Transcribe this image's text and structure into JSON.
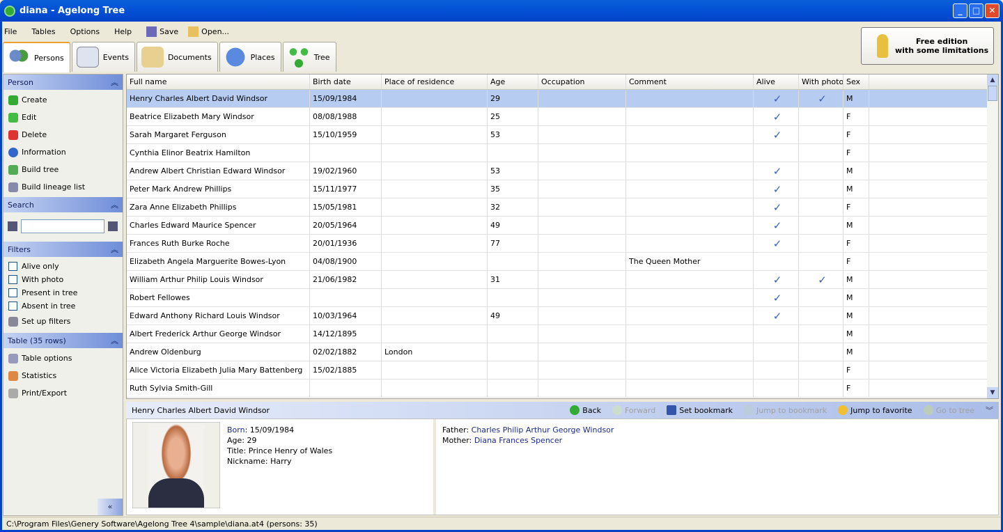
{
  "window": {
    "title": "diana - Agelong Tree"
  },
  "menu": [
    "File",
    "Tables",
    "Options",
    "Help"
  ],
  "toolbar": {
    "save": "Save",
    "open": "Open..."
  },
  "tabs": [
    "Persons",
    "Events",
    "Documents",
    "Places",
    "Tree"
  ],
  "edition": {
    "line1": "Free edition",
    "line2": "with some limitations"
  },
  "left": {
    "person": {
      "title": "Person",
      "items": [
        "Create",
        "Edit",
        "Delete",
        "Information",
        "Build tree",
        "Build lineage list"
      ]
    },
    "search": {
      "title": "Search",
      "value": ""
    },
    "filters": {
      "title": "Filters",
      "checks": [
        "Alive only",
        "With photo",
        "Present in tree",
        "Absent in tree"
      ],
      "setup": "Set up filters"
    },
    "table": {
      "title": "Table (35 rows)",
      "items": [
        "Table options",
        "Statistics",
        "Print/Export"
      ]
    }
  },
  "grid": {
    "columns": [
      "Full name",
      "Birth date",
      "Place of residence",
      "Age",
      "Occupation",
      "Comment",
      "Alive",
      "With photo",
      "Sex"
    ],
    "check": "✓",
    "rows": [
      [
        "Henry Charles Albert David Windsor",
        "15/09/1984",
        "",
        "29",
        "",
        "",
        true,
        true,
        "M"
      ],
      [
        "Beatrice Elizabeth Mary Windsor",
        "08/08/1988",
        "",
        "25",
        "",
        "",
        true,
        false,
        "F"
      ],
      [
        "Sarah Margaret Ferguson",
        "15/10/1959",
        "",
        "53",
        "",
        "",
        true,
        false,
        "F"
      ],
      [
        "Cynthia Elinor Beatrix Hamilton",
        "",
        "",
        "",
        "",
        "",
        false,
        false,
        "F"
      ],
      [
        "Andrew Albert Christian Edward Windsor",
        "19/02/1960",
        "",
        "53",
        "",
        "",
        true,
        false,
        "M"
      ],
      [
        "Peter Mark Andrew Phillips",
        "15/11/1977",
        "",
        "35",
        "",
        "",
        true,
        false,
        "M"
      ],
      [
        "Zara Anne Elizabeth Phillips",
        "15/05/1981",
        "",
        "32",
        "",
        "",
        true,
        false,
        "F"
      ],
      [
        "Charles Edward Maurice Spencer",
        "20/05/1964",
        "",
        "49",
        "",
        "",
        true,
        false,
        "M"
      ],
      [
        "Frances Ruth Burke Roche",
        "20/01/1936",
        "",
        "77",
        "",
        "",
        true,
        false,
        "F"
      ],
      [
        "Elizabeth Angela Marguerite Bowes-Lyon",
        "04/08/1900",
        "",
        "",
        "",
        "The Queen Mother",
        false,
        false,
        "F"
      ],
      [
        "William Arthur Philip Louis Windsor",
        "21/06/1982",
        "",
        "31",
        "",
        "",
        true,
        true,
        "M"
      ],
      [
        "Robert Fellowes",
        "",
        "",
        "",
        "",
        "",
        true,
        false,
        "M"
      ],
      [
        "Edward Anthony Richard Louis Windsor",
        "10/03/1964",
        "",
        "49",
        "",
        "",
        true,
        false,
        "M"
      ],
      [
        "Albert Frederick Arthur George Windsor",
        "14/12/1895",
        "",
        "",
        "",
        "",
        false,
        false,
        "M"
      ],
      [
        "Andrew Oldenburg",
        "02/02/1882",
        "London",
        "",
        "",
        "",
        false,
        false,
        "M"
      ],
      [
        "Alice Victoria Elizabeth Julia Mary Battenberg",
        "15/02/1885",
        "",
        "",
        "",
        "",
        false,
        false,
        "F"
      ],
      [
        "Ruth Sylvia Smith-Gill",
        "",
        "",
        "",
        "",
        "",
        false,
        false,
        "F"
      ]
    ]
  },
  "details": {
    "name": "Henry Charles Albert David Windsor",
    "nav": {
      "back": "Back",
      "forward": "Forward",
      "set_bookmark": "Set bookmark",
      "jump_bookmark": "Jump to bookmark",
      "jump_favorite": "Jump to favorite",
      "go_tree": "Go to tree"
    },
    "born_label": "Born",
    "born": ": 15/09/1984",
    "age": "Age: 29",
    "title": "Title: Prince Henry of Wales",
    "nickname": "Nickname: Harry",
    "father_label": "Father: ",
    "father": "Charles Philip Arthur George Windsor",
    "mother_label": "Mother: ",
    "mother": "Diana Frances Spencer"
  },
  "status": "C:\\Program Files\\Genery Software\\Agelong Tree 4\\sample\\diana.at4 (persons: 35)"
}
